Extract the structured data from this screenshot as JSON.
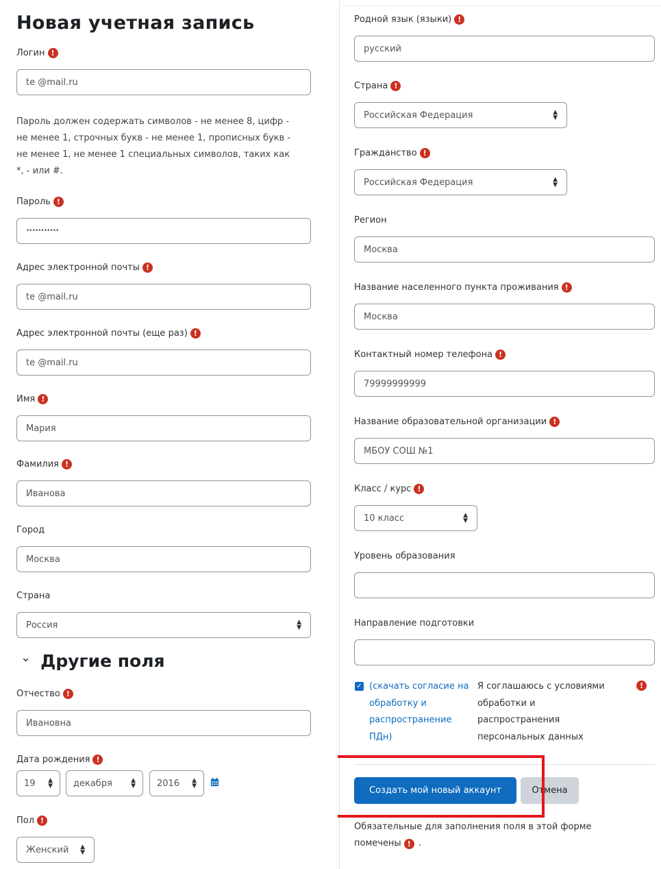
{
  "title": "Новая учетная запись",
  "required_icon": "!",
  "left": {
    "login": {
      "label": "Логин",
      "value": "te             @mail.ru"
    },
    "password_help": [
      "Пароль должен содержать символов - не менее 8, цифр -",
      "не менее 1, строчных букв - не менее 1, прописных букв -",
      "не менее 1, не менее 1 специальных символов, таких как",
      "*, - или #."
    ],
    "password": {
      "label": "Пароль",
      "value": "•••••••••••"
    },
    "email": {
      "label": "Адрес электронной почты",
      "value": "te             @mail.ru"
    },
    "email2": {
      "label": "Адрес электронной почты (еще раз)",
      "value": "te             @mail.ru"
    },
    "firstname": {
      "label": "Имя",
      "value": "Мария"
    },
    "lastname": {
      "label": "Фамилия",
      "value": "Иванова"
    },
    "city": {
      "label": "Город",
      "value": "Москва"
    },
    "country": {
      "label": "Страна",
      "value": "Россия"
    },
    "other_section": {
      "chevron": "⌄",
      "title": "Другие поля"
    },
    "patronymic": {
      "label": "Отчество",
      "value": "Ивановна"
    },
    "birthdate": {
      "label": "Дата рождения",
      "day": "19",
      "month": "декабря",
      "year": "2016"
    },
    "gender": {
      "label": "Пол",
      "value": "Женский"
    }
  },
  "right": {
    "native_language": {
      "label": "Родной язык (языки)",
      "value": "русский"
    },
    "country": {
      "label": "Страна",
      "value": "Российская Федерация"
    },
    "citizenship": {
      "label": "Гражданство",
      "value": "Российская Федерация"
    },
    "region": {
      "label": "Регион",
      "value": "Москва"
    },
    "settlement": {
      "label": "Название населенного пункта проживания",
      "value": "Москва"
    },
    "phone": {
      "label": "Контактный номер телефона",
      "value": "79999999999"
    },
    "organization": {
      "label": "Название образовательной организации",
      "value": "МБОУ СОШ №1"
    },
    "grade": {
      "label": "Класс / курс",
      "value": "10 класс"
    },
    "edu_level": {
      "label": "Уровень образования",
      "value": ""
    },
    "direction": {
      "label": "Направление подготовки",
      "value": ""
    },
    "consent": {
      "checked": true,
      "link_lines": [
        "(скачать согласие на",
        "обработку и",
        "распространение",
        "ПДн)"
      ],
      "text_lines": [
        "Я соглашаюсь с условиями",
        "обработки и",
        "распространения",
        "персональных данных"
      ]
    },
    "create_button": "Создать мой новый аккаунт",
    "cancel_button": "Отмена",
    "required_note_line1": "Обязательные для заполнения поля в этой форме",
    "required_note_line2": "помечены",
    "required_note_end": "."
  },
  "colors": {
    "primary": "#0f6cbf",
    "required": "#ca3120",
    "highlight": "#e8151b"
  }
}
